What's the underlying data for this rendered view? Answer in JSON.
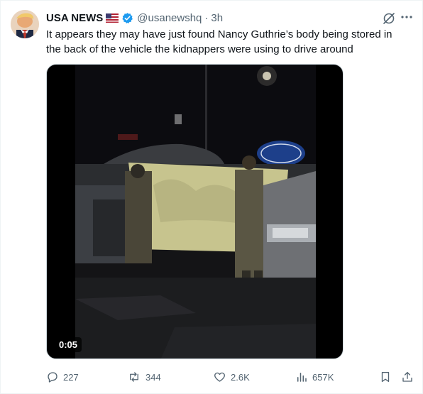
{
  "author": {
    "name": "USA NEWS",
    "handle": "@usanewshq",
    "separator": "·",
    "time": "3h",
    "flag": "us-flag-icon",
    "verified": "verified-badge-icon"
  },
  "tweet": {
    "text": "It appears they may have just found Nancy Guthrie’s body being stored in the back of the vehicle the kidnappers were using to drive around"
  },
  "media": {
    "type": "video",
    "duration": "0:05"
  },
  "actions": {
    "replies": "227",
    "reposts": "344",
    "likes": "2.6K",
    "views": "657K"
  },
  "colors": {
    "text": "#0f1419",
    "secondary": "#536471",
    "verified": "#1d9bf0"
  }
}
